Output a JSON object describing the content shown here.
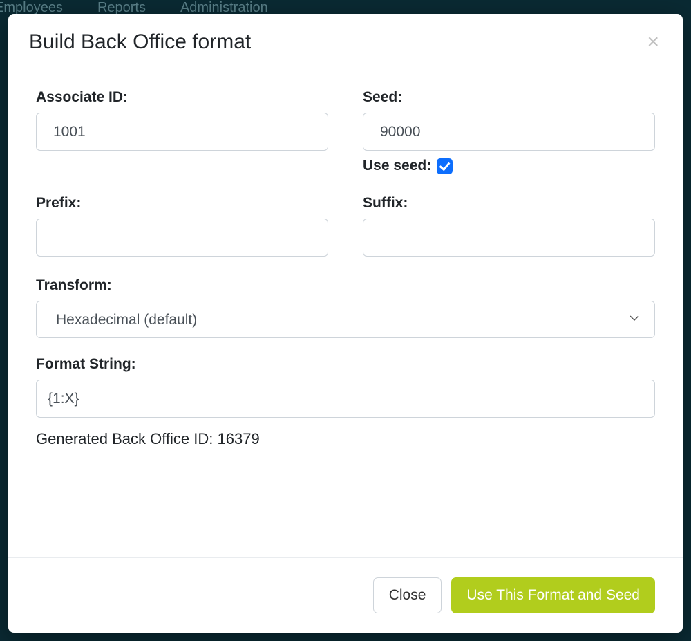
{
  "nav": {
    "items": [
      "Employees",
      "Reports",
      "Administration"
    ]
  },
  "modal": {
    "title": "Build Back Office format",
    "close_symbol": "×",
    "fields": {
      "associate_id": {
        "label": "Associate ID:",
        "value": "1001"
      },
      "seed": {
        "label": "Seed:",
        "value": "90000"
      },
      "use_seed": {
        "label": "Use seed:",
        "checked": true
      },
      "prefix": {
        "label": "Prefix:",
        "value": ""
      },
      "suffix": {
        "label": "Suffix:",
        "value": ""
      },
      "transform": {
        "label": "Transform:",
        "selected": "Hexadecimal (default)"
      },
      "format_string": {
        "label": "Format String:",
        "value": "{1:X}"
      }
    },
    "generated": {
      "label": "Generated Back Office ID: ",
      "value": "16379"
    },
    "footer": {
      "close": "Close",
      "submit": "Use This Format and Seed"
    }
  }
}
